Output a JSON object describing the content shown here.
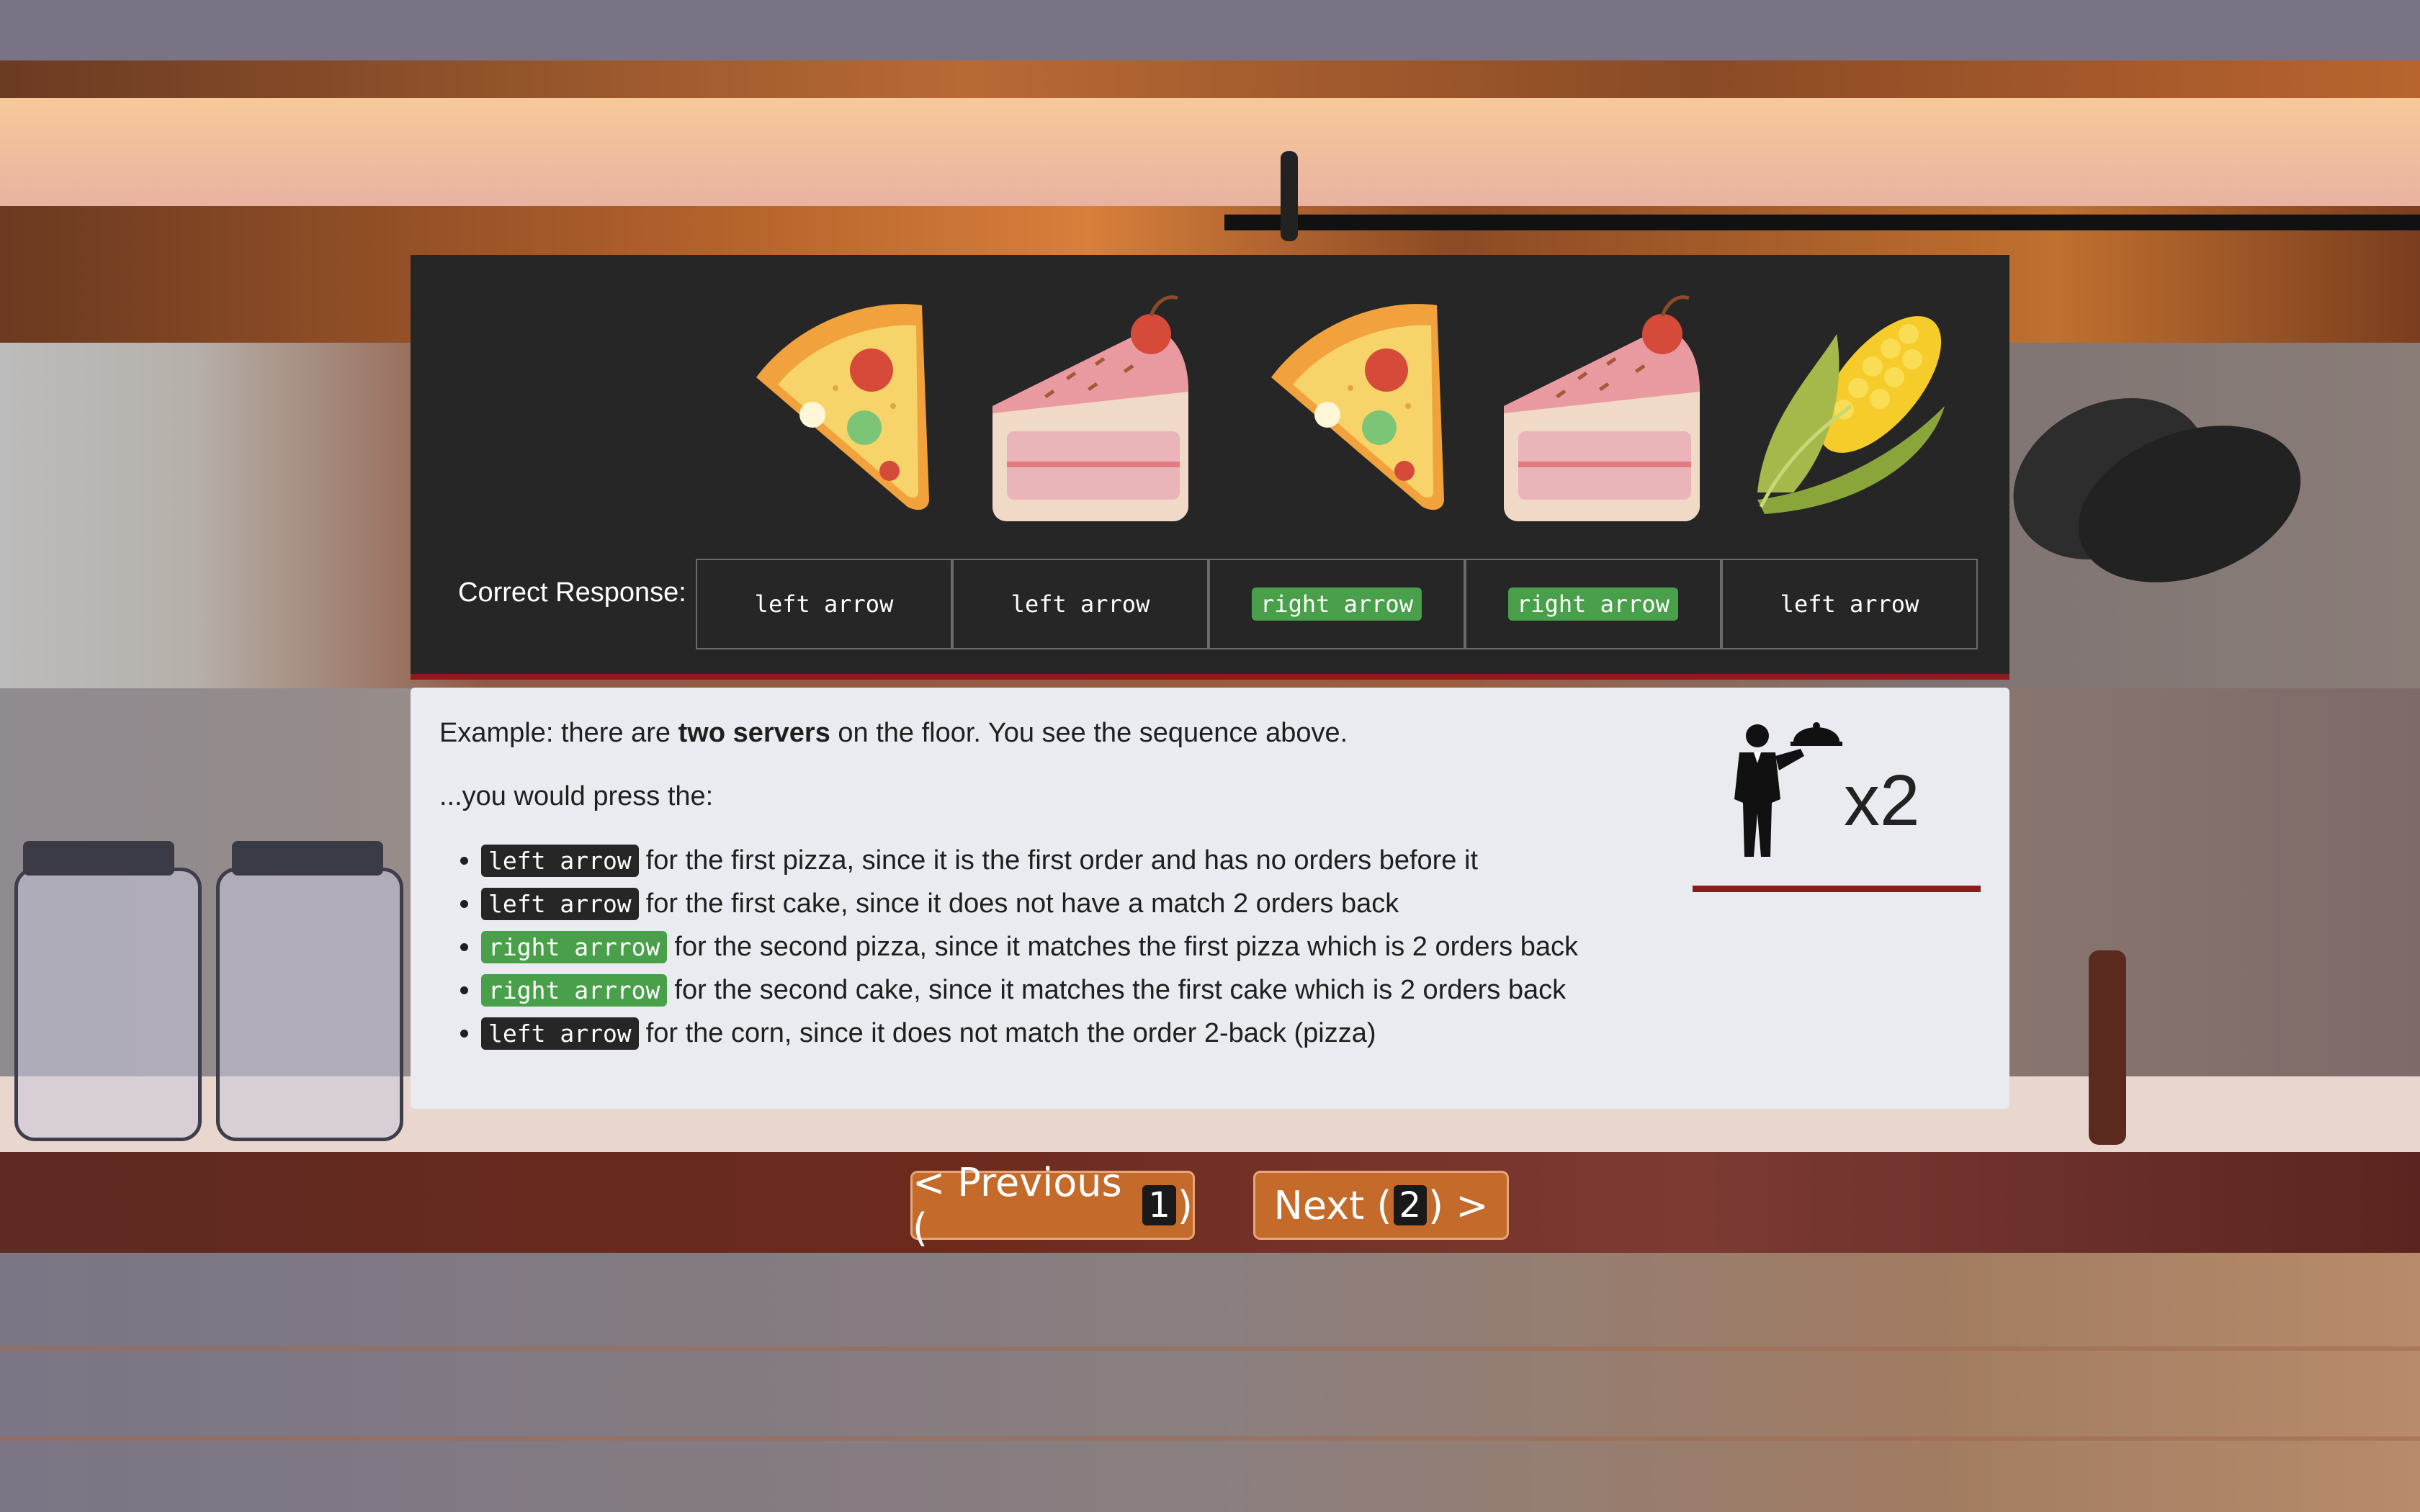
{
  "food_sequence": [
    {
      "icon": "pizza-slice-icon",
      "name": "pizza"
    },
    {
      "icon": "cake-slice-icon",
      "name": "cake"
    },
    {
      "icon": "pizza-slice-icon",
      "name": "pizza"
    },
    {
      "icon": "cake-slice-icon",
      "name": "cake"
    },
    {
      "icon": "corn-icon",
      "name": "corn"
    }
  ],
  "correct_response": {
    "label": "Correct Response:",
    "cells": [
      {
        "text": "left arrow",
        "highlight": false
      },
      {
        "text": "left arrow",
        "highlight": false
      },
      {
        "text": "right arrow",
        "highlight": true
      },
      {
        "text": "right arrow",
        "highlight": true
      },
      {
        "text": "left arrow",
        "highlight": false
      }
    ]
  },
  "example": {
    "line1_pre": "Example: there are ",
    "line1_bold": "two servers",
    "line1_post": " on the floor. You see the sequence above.",
    "line2": "...you would press the:",
    "bullets": [
      {
        "key": "left arrow",
        "green": false,
        "text": "for the first pizza, since it is the first order and has no orders before it"
      },
      {
        "key": "left arrow",
        "green": false,
        "text": "for the first cake, since it does not have a match 2 orders back"
      },
      {
        "key": "right arrrow",
        "green": true,
        "text": "for the second pizza, since it matches the first pizza which is 2 orders back"
      },
      {
        "key": "right arrrow",
        "green": true,
        "text": "for the second cake, since it matches the first cake which is 2 orders back"
      },
      {
        "key": "left arrow",
        "green": false,
        "text": "for the corn, since it does not match the order 2-back (pizza)"
      }
    ],
    "server_multiplier": "x2"
  },
  "navigation": {
    "previous_label": "< Previous (",
    "previous_key": "1",
    "previous_close": ")",
    "next_label": "Next (",
    "next_key": "2",
    "next_close": ") >"
  },
  "colors": {
    "accent_red": "#8e1b1b",
    "key_green": "#4aa04a",
    "button_orange": "#c46a2a"
  }
}
